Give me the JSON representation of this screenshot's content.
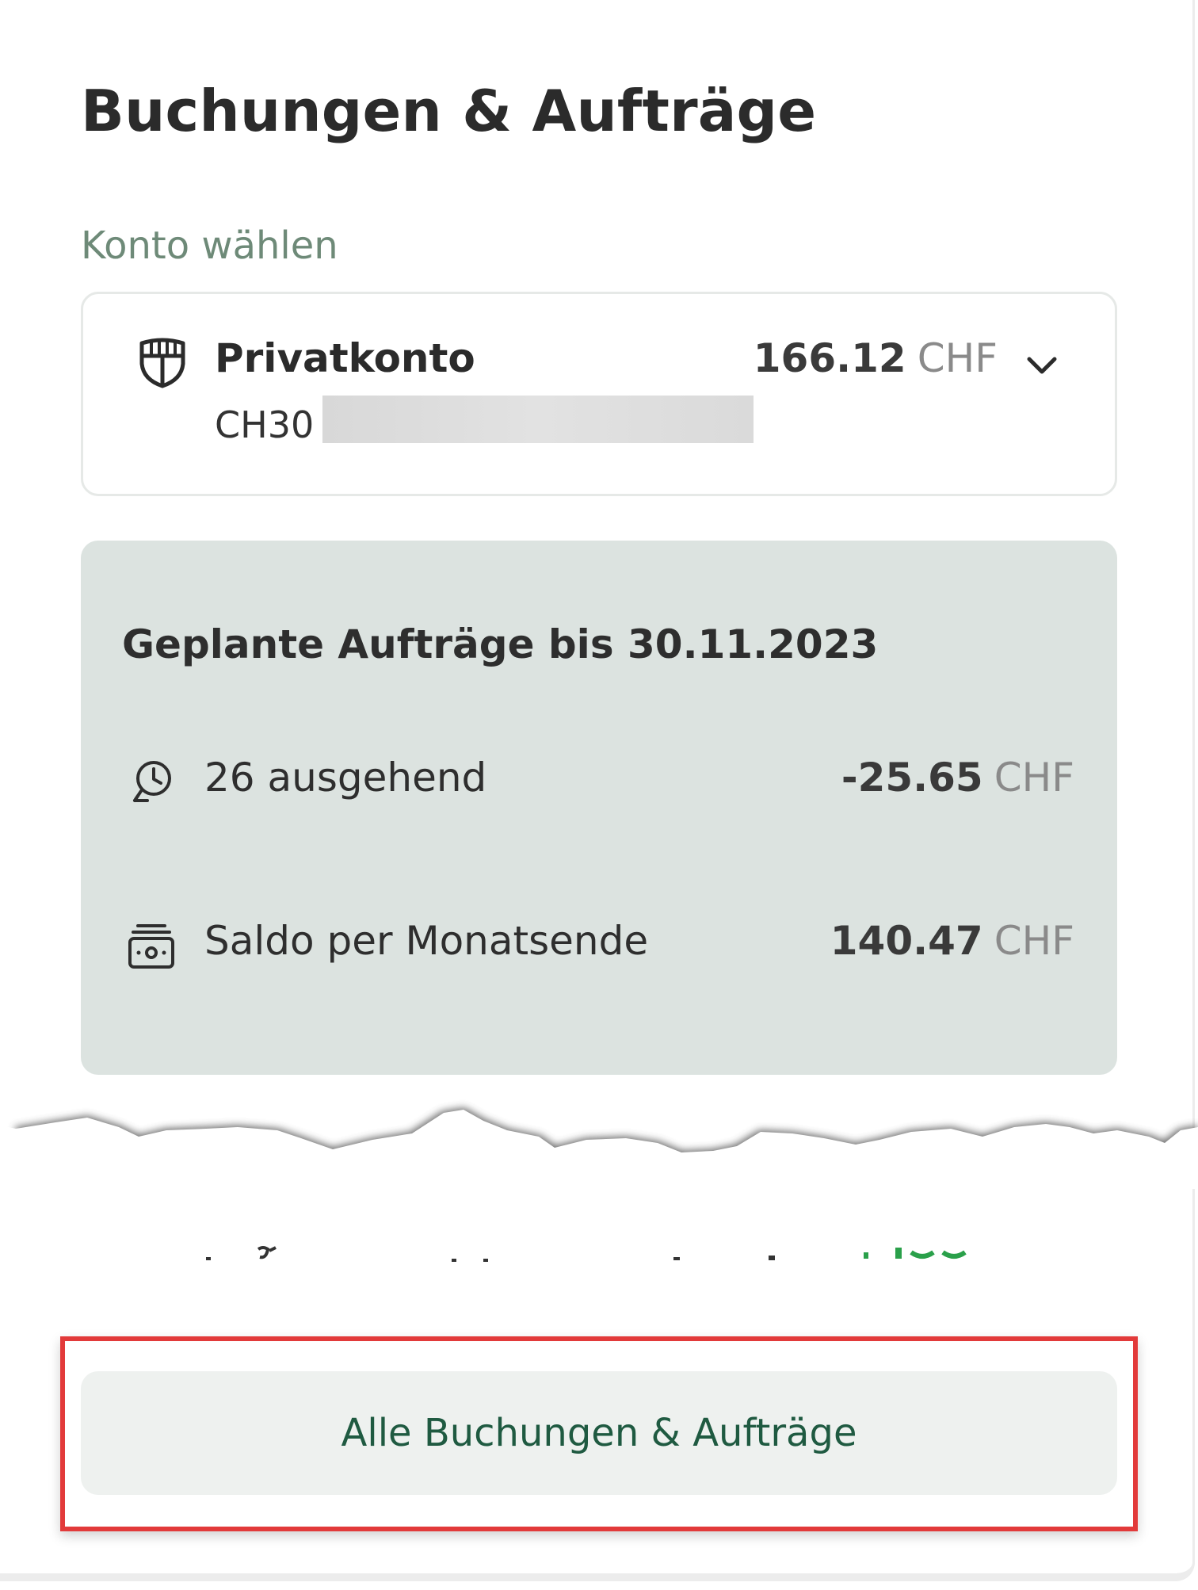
{
  "header": {
    "title": "Buchungen & Aufträge"
  },
  "account_select": {
    "label": "Konto wählen",
    "icon": "shield-icon",
    "name": "Privatkonto",
    "iban_prefix": "CH30",
    "balance": "166.12",
    "currency": "CHF",
    "chevron_icon": "chevron-down-icon"
  },
  "planned": {
    "title": "Geplante Aufträge bis 30.11.2023",
    "rows": [
      {
        "icon": "clock-return-icon",
        "label": "26 ausgehend",
        "amount": "-25.65",
        "currency": "CHF"
      },
      {
        "icon": "cash-stack-icon",
        "label": "Saldo per Monatsende",
        "amount": "140.47",
        "currency": "CHF"
      }
    ]
  },
  "footer": {
    "all_button_label": "Alle Buchungen & Aufträge"
  },
  "colors": {
    "accent_green": "#1f5a41",
    "label_green": "#6e8a78",
    "panel_bg": "#dce3e0",
    "highlight_red": "#e23a3a"
  }
}
